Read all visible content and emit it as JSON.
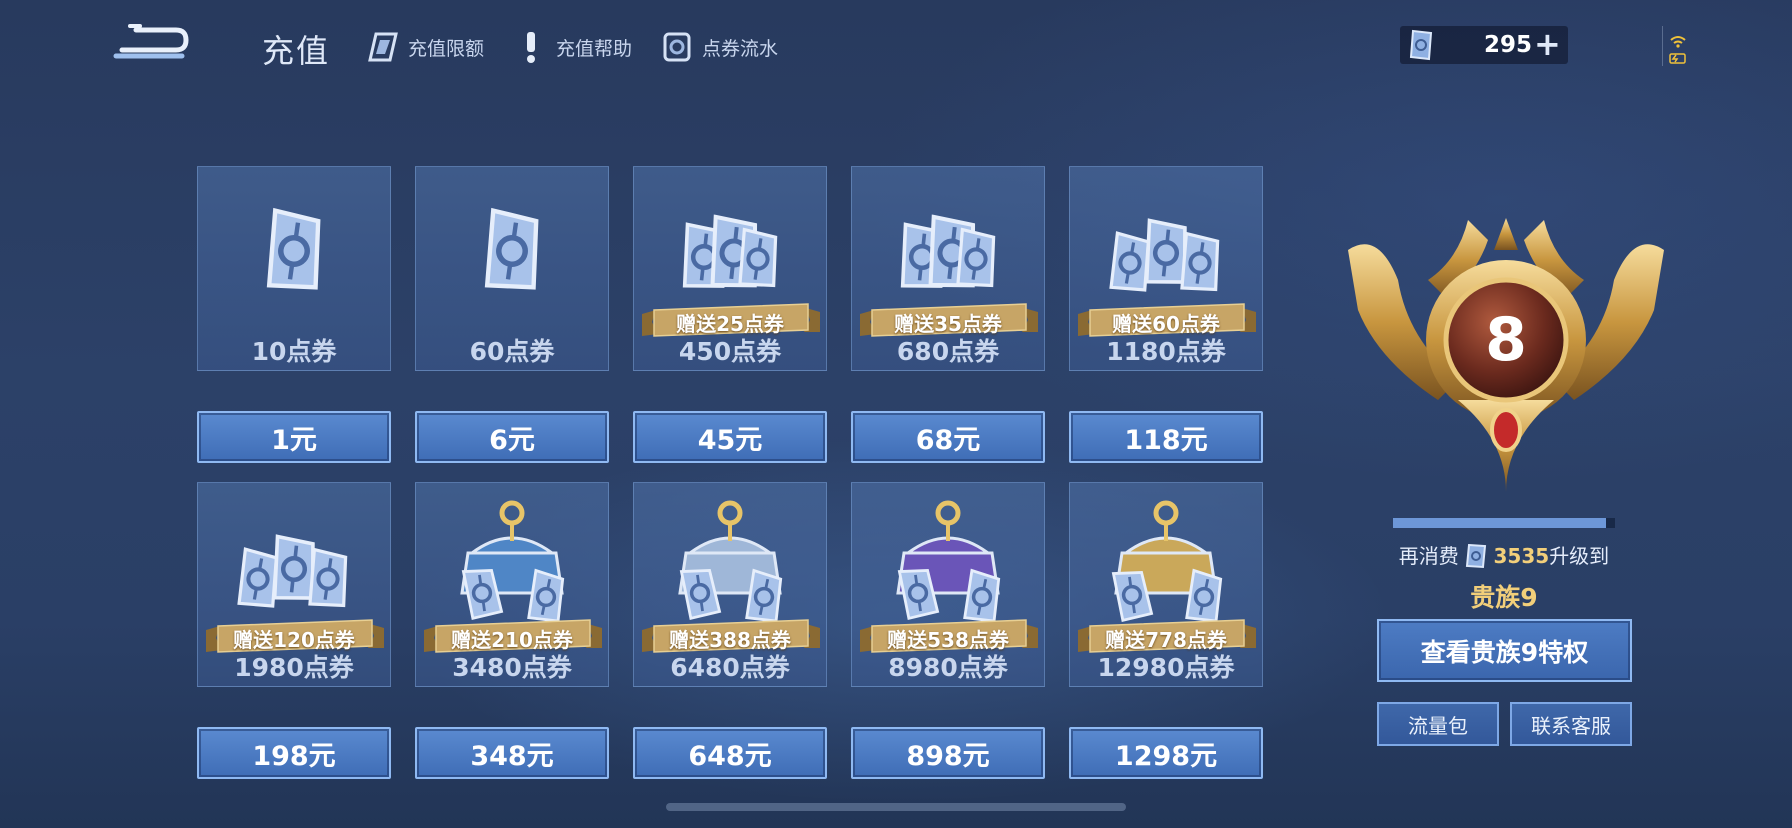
{
  "header": {
    "title": "充值",
    "links": [
      {
        "label": "充值限额",
        "icon": "ticket-card-icon"
      },
      {
        "label": "充值帮助",
        "icon": "exclamation-icon"
      },
      {
        "label": "点券流水",
        "icon": "coupon-flow-icon"
      }
    ],
    "balance": "295",
    "balance_plus": "+"
  },
  "packages": [
    {
      "amount": "10点券",
      "price": "1元",
      "bonus": "",
      "art": "single-coupon-icon"
    },
    {
      "amount": "60点券",
      "price": "6元",
      "bonus": "",
      "art": "single-coupon-icon"
    },
    {
      "amount": "450点券",
      "price": "45元",
      "bonus": "赠送25点券",
      "art": "coupon-stack-icon"
    },
    {
      "amount": "680点券",
      "price": "68元",
      "bonus": "赠送35点券",
      "art": "coupon-stack-icon"
    },
    {
      "amount": "1180点券",
      "price": "118元",
      "bonus": "赠送60点券",
      "art": "coupon-pile-icon"
    },
    {
      "amount": "1980点券",
      "price": "198元",
      "bonus": "赠送120点券",
      "art": "coupon-pile-icon"
    },
    {
      "amount": "3480点券",
      "price": "348元",
      "bonus": "赠送210点券",
      "art": "blue-chest-icon"
    },
    {
      "amount": "6480点券",
      "price": "648元",
      "bonus": "赠送388点券",
      "art": "silver-chest-icon"
    },
    {
      "amount": "8980点券",
      "price": "898元",
      "bonus": "赠送538点券",
      "art": "purple-chest-icon"
    },
    {
      "amount": "12980点券",
      "price": "1298元",
      "bonus": "赠送778点券",
      "art": "gold-chest-icon"
    }
  ],
  "nobility": {
    "level": "8",
    "progress": 0.96,
    "upgrade_prefix": "再消费",
    "upgrade_amount": "3535",
    "upgrade_suffix": "升级到",
    "next_level": "贵族9",
    "view_button": "查看贵族9特权",
    "data_pack_button": "流量包",
    "support_button": "联系客服"
  },
  "colors": {
    "accent_gold": "#f2cf7a",
    "button_blue": "#3f6db6",
    "background": "#2c4168"
  }
}
